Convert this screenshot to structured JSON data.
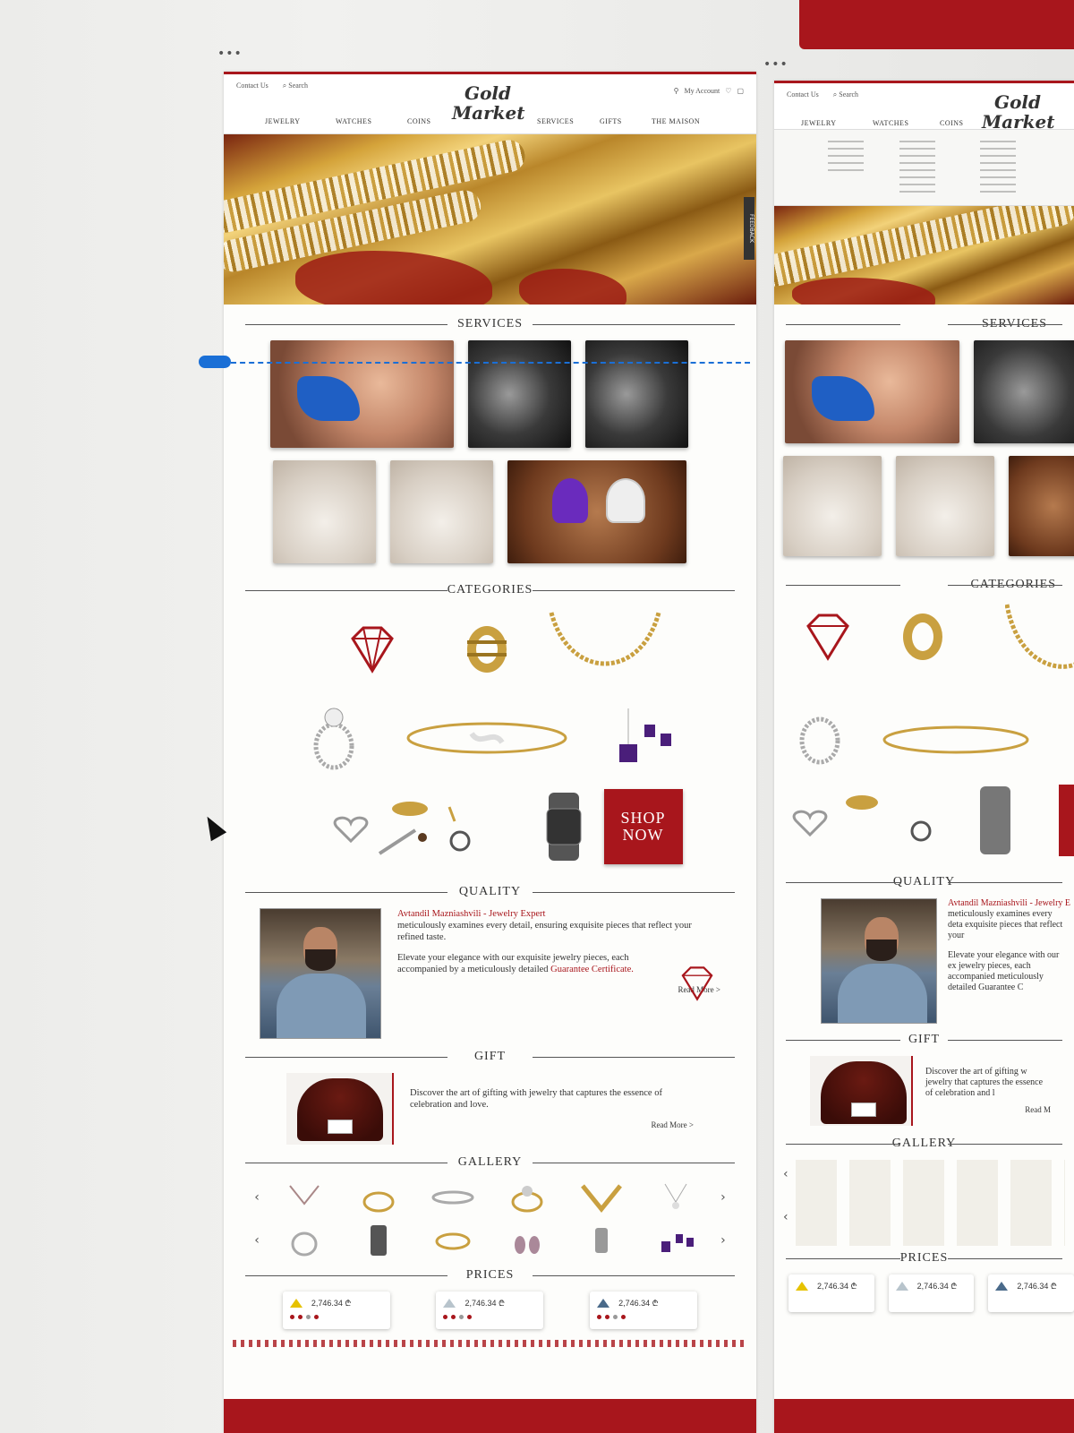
{
  "header": {
    "contact": "Contact Us",
    "search": "Search",
    "account": "My Account",
    "logo_line1": "Gold",
    "logo_line2": "Market",
    "nav": [
      "JEWELRY",
      "WATCHES",
      "COINS",
      "SERVICES",
      "GIFTS",
      "THE MAISON"
    ]
  },
  "hero": {
    "feedback": "FEEDBACK"
  },
  "sections": {
    "services": "SERVICES",
    "categories": "CATEGORIES",
    "quality": "QUALITY",
    "gift": "GIFT",
    "gallery": "GALLERY",
    "prices": "PRICES"
  },
  "shop_now": {
    "line1": "SHOP",
    "line2": "NOW"
  },
  "quality": {
    "name": "Avtandil Mazniashvili - Jewelry Expert",
    "text1": "meticulously examines every detail, ensuring exquisite pieces that reflect your refined taste.",
    "text2a": "Elevate your elegance with our exquisite jewelry pieces, each accompanied by a meticulously detailed",
    "text2b": "Guarantee Certificate.",
    "read_more": "Read More >"
  },
  "gift": {
    "text": "Discover the art of gifting with jewelry that captures the essence of celebration and love.",
    "read_more": "Read More >"
  },
  "gallery": {
    "prev": "‹",
    "next": "›"
  },
  "prices": [
    {
      "value": "2,746.34 ₾",
      "color": "#e6c200"
    },
    {
      "value": "2,746.34 ₾",
      "color": "#b8c4cc"
    },
    {
      "value": "2,746.34 ₾",
      "color": "#4a6a8a"
    }
  ],
  "colors": {
    "brand_red": "#a8161c",
    "gold": "#c9a040",
    "annotation_blue": "#1a6fd6"
  },
  "second_board": {
    "services": "SERVICES",
    "categories": "CATEGORIES",
    "quality": "QUALITY",
    "name": "Avtandil Mazniashvili - Jewelry E",
    "text1": "meticulously examines every deta exquisite pieces that reflect your",
    "text2": "Elevate your elegance with our ex jewelry pieces, each accompanied meticulously detailed Guarantee C",
    "gift": "GIFT",
    "gift_text": "Discover the art of gifting w jewelry that captures the essence of celebration and l",
    "read_more": "Read M",
    "gallery": "GALLERY",
    "prices": "PRICES",
    "price_value": "2,746.34 ₾"
  }
}
